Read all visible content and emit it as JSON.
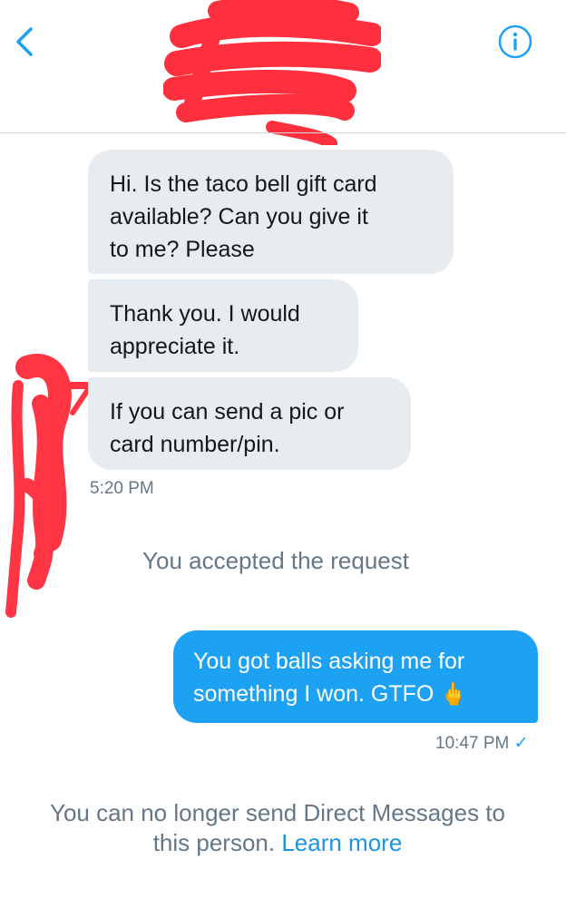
{
  "messages": [
    {
      "lines": [
        "Hi. Is the taco bell gift card",
        "available? Can you give it",
        "to me? Please"
      ]
    },
    {
      "lines": [
        "Thank you. I would",
        "appreciate it."
      ]
    },
    {
      "lines": [
        "If you can send a pic or",
        "card number/pin."
      ]
    }
  ],
  "received_timestamp": "5:20 PM",
  "system_note": "You accepted the request",
  "reply": {
    "lines": [
      "You got balls asking me for",
      "something I won. GTFO"
    ],
    "emoji": "🖕",
    "timestamp": "10:47 PM",
    "status_icon": "✓"
  },
  "footer": {
    "line1": "You can no longer send Direct Messages to",
    "line2": "this person.",
    "link": "Learn more"
  },
  "icons": {
    "back": "chevron-left-icon",
    "info": "info-icon"
  },
  "colors": {
    "accent": "#1da1f2",
    "incoming_bubble": "#e6ecf0",
    "muted_text": "#657786",
    "redaction": "#ff1a2a"
  }
}
